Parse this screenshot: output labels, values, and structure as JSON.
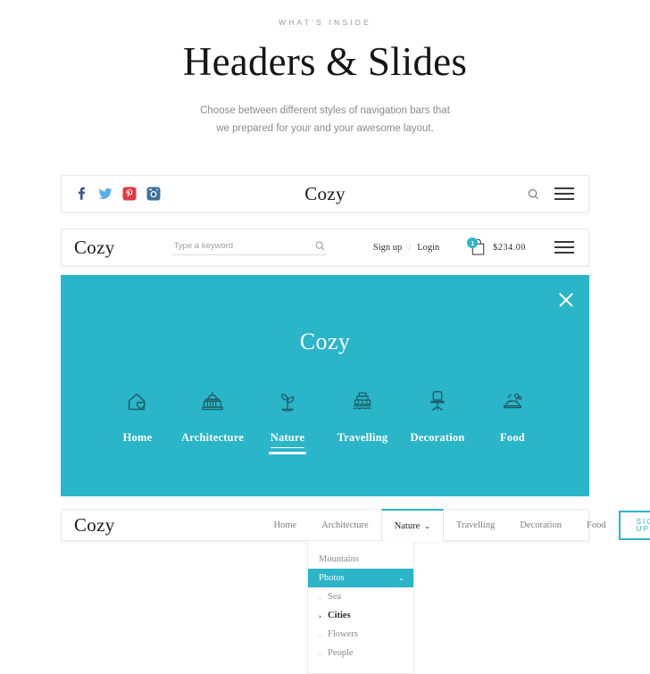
{
  "intro": {
    "kicker": "WHAT'S INSIDE",
    "title": "Headers & Slides",
    "subtitle": "Choose between different styles of navigation bars that we prepared for your and your awesome layout."
  },
  "colors": {
    "accent_teal": "#2bb5c8",
    "facebook": "#3b5998",
    "twitter": "#55acee",
    "pinterest": "#e03b41",
    "instagram": "#3f6f9a",
    "text_dark": "#1b1b1b",
    "text_muted": "#8b8b8b"
  },
  "header_social": {
    "brand": "Cozy",
    "social": [
      {
        "name": "facebook-icon",
        "label": "Facebook"
      },
      {
        "name": "twitter-icon",
        "label": "Twitter"
      },
      {
        "name": "pinterest-icon",
        "label": "Pinterest"
      },
      {
        "name": "instagram-icon",
        "label": "Instagram"
      }
    ],
    "search_icon": "search-icon",
    "menu_icon": "hamburger-icon"
  },
  "header_shop": {
    "brand": "Cozy",
    "search_placeholder": "Type a keyword",
    "search_value": "",
    "search_icon": "search-icon",
    "signup_label": "Sign up",
    "separator": "/",
    "login_label": "Login",
    "cart_icon": "shopping-bag-icon",
    "cart_count": "1",
    "cart_total": "$234.00",
    "menu_icon": "hamburger-icon"
  },
  "overlay_menu": {
    "brand": "Cozy",
    "close_icon": "close-icon",
    "items": [
      {
        "label": "Home",
        "icon": "house-heart-icon",
        "active": false
      },
      {
        "label": "Architecture",
        "icon": "classical-building-icon",
        "active": false
      },
      {
        "label": "Nature",
        "icon": "plant-sapling-icon",
        "active": true
      },
      {
        "label": "Travelling",
        "icon": "ship-icon",
        "active": false
      },
      {
        "label": "Decoration",
        "icon": "office-chair-icon",
        "active": false
      },
      {
        "label": "Food",
        "icon": "food-platter-icon",
        "active": false
      }
    ]
  },
  "header_nav": {
    "brand": "Cozy",
    "items": [
      {
        "label": "Home",
        "active": false,
        "has_caret": false
      },
      {
        "label": "Architecture",
        "active": false,
        "has_caret": false
      },
      {
        "label": "Nature",
        "active": true,
        "has_caret": true
      },
      {
        "label": "Travelling",
        "active": false,
        "has_caret": false
      },
      {
        "label": "Decoration",
        "active": false,
        "has_caret": false
      },
      {
        "label": "Food",
        "active": false,
        "has_caret": false
      }
    ],
    "caret_glyph": "⌄",
    "signup_label": "SIGN UP"
  },
  "dropdown": {
    "items": [
      {
        "label": "Mountains",
        "type": "top",
        "selected": false
      },
      {
        "label": "Photos",
        "type": "top",
        "selected": true,
        "caret": "⌄"
      },
      {
        "label": "Sea",
        "type": "sub",
        "marker": "›",
        "strong": false
      },
      {
        "label": "Cities",
        "type": "sub",
        "marker": "›",
        "strong": true
      },
      {
        "label": "Flowers",
        "type": "sub",
        "marker": "›",
        "strong": false
      },
      {
        "label": "People",
        "type": "sub",
        "marker": "›",
        "strong": false
      }
    ]
  }
}
